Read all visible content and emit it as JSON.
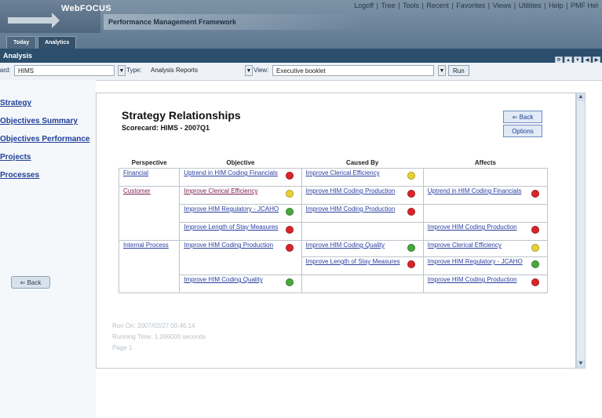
{
  "brand": {
    "logo": "WebFOCUS",
    "framework": "Performance Management Framework"
  },
  "header": {
    "links": [
      "Logoff",
      "Tree",
      "Tools",
      "Recent",
      "Favorites",
      "Views",
      "Utilities",
      "Help",
      "PMF Hel"
    ]
  },
  "tabs": [
    "Today",
    "Analytics"
  ],
  "analysis_bar": {
    "title": "Analysis"
  },
  "filters": {
    "card_label": "Card:",
    "card_value": "HIMS",
    "type_label": "Type:",
    "type_value": "Analysis Reports",
    "view_label": "View:",
    "view_value": "Executive booklet",
    "run_label": "Run"
  },
  "sidebar": {
    "items": [
      "Strategy",
      "Objectives Summary",
      "Objectives Performance",
      "Projects",
      "Processes"
    ],
    "back_label": "Back"
  },
  "report": {
    "title": "Strategy Relationships",
    "subtitle": "Scorecard: HIMS - 2007Q1",
    "back_label": "Back",
    "options_label": "Options",
    "columns": [
      "Perspective",
      "Objective",
      "Caused By",
      "Affects"
    ],
    "cells": {
      "financial": "Financial",
      "customer": "Customer",
      "internal": "Internal Process",
      "obj_upfinancials": "Uptrend in HIM Coding Financials",
      "obj_ice": "Improve Clerical Efficiency",
      "obj_reg": "Improve HIM Regulatory - JCAHO",
      "obj_los": "Improve Length of Stay Measures",
      "obj_prod": "Improve HIM Coding Production",
      "obj_qual": "Improve HIM Coding Quality",
      "cb_ice": "Improve Clerical Efficiency",
      "cb_prod1": "Improve HIM Coding Production",
      "cb_prod2": "Improve HIM Coding Production",
      "cb_qual": "Improve HIM Coding Quality",
      "cb_los": "Improve Length of Stay Measures",
      "af_upfinancials": "Uptrend in HIM Coding Financials",
      "af_prod1": "Improve HIM Coding Production",
      "af_ice": "Improve Clerical Efficiency",
      "af_reg": "Improve HIM Regulatory - JCAHO",
      "af_prod2": "Improve HIM Coding Production"
    },
    "status_colors": {
      "red": "#d9242a",
      "yellow": "#e8d231",
      "green": "#48a83e"
    },
    "run_on": "Run On: 2007/02/27 00.46.14",
    "running_time": "Running Time: 1.266000 seconds",
    "page": "Page 1"
  }
}
